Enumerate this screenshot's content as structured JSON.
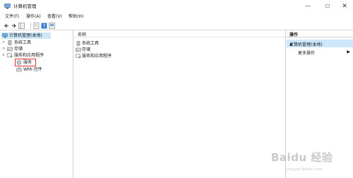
{
  "window": {
    "title": "计算机管理",
    "minimize_glyph": "—",
    "maximize_glyph": "☐",
    "close_glyph": "✕"
  },
  "menubar": [
    "文件(F)",
    "操作(A)",
    "查看(V)",
    "帮助(H)"
  ],
  "toolbar": {
    "icons": [
      "back-arrow-icon",
      "forward-arrow-icon",
      "show-hide-tree-icon",
      "properties-icon",
      "help-icon",
      "console-icon"
    ]
  },
  "tree": {
    "root": "计算机管理(本地)",
    "items": [
      "系统工具",
      "存储",
      "服务和应用程序",
      "服务",
      "WMI 控件"
    ]
  },
  "main": {
    "column_header": "名称",
    "items": [
      "系统工具",
      "存储",
      "服务和应用程序"
    ]
  },
  "actions": {
    "header": "操作",
    "section": "计算机管理(本地)",
    "more": "更多操作",
    "section_arrow": "▲",
    "more_arrow": "▶"
  },
  "watermark": {
    "text": "Baidu 经验",
    "url": "jingyan.baidu.com"
  },
  "colors": {
    "selection": "#cde8fb",
    "highlight_box": "#e0322e"
  }
}
